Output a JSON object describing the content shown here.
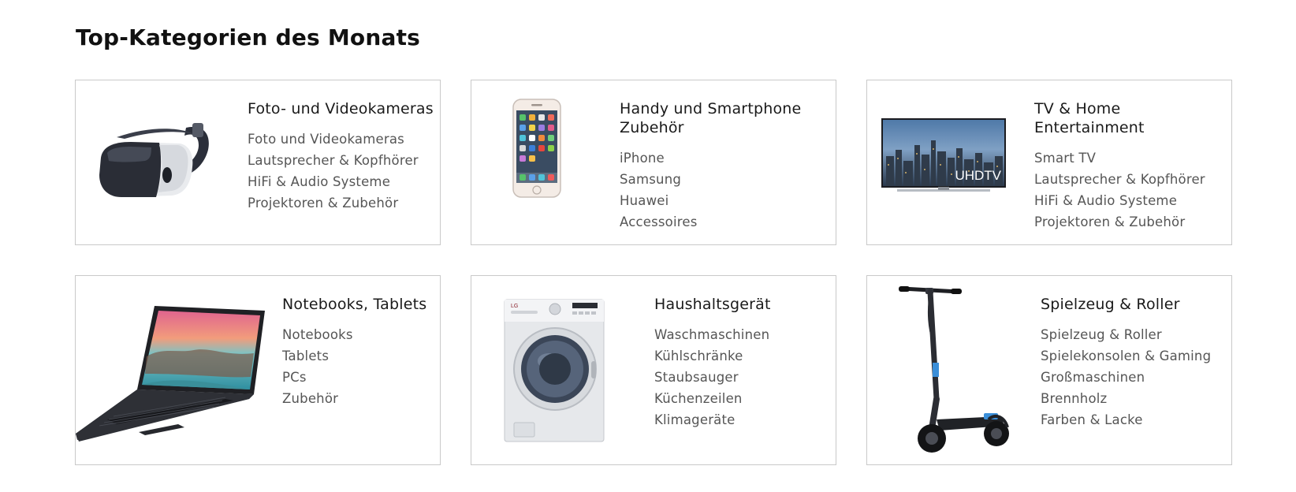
{
  "section": {
    "title": "Top-Kategorien des Monats"
  },
  "cards": [
    {
      "title": "Foto- und Videokameras",
      "icon": "vr-headset-image",
      "links": [
        "Foto und Videokameras",
        "Lautsprecher & Kopfhörer",
        "HiFi & Audio Systeme",
        "Projektoren & Zubehör"
      ]
    },
    {
      "title": "Handy und Smartphone Zubehör",
      "icon": "smartphone-image",
      "links": [
        "iPhone",
        "Samsung",
        "Huawei",
        "Accessoires"
      ]
    },
    {
      "title": "TV & Home Entertainment",
      "icon": "tv-image",
      "tv_badge": "UHDTV",
      "links": [
        "Smart TV",
        "Lautsprecher & Kopfhörer",
        "HiFi & Audio Systeme",
        "Projektoren & Zubehör"
      ]
    },
    {
      "title": "Notebooks, Tablets",
      "icon": "laptop-image",
      "links": [
        "Notebooks",
        "Tablets",
        "PCs",
        "Zubehör"
      ]
    },
    {
      "title": "Haushaltsgerät",
      "icon": "washing-machine-image",
      "brand_mark": "LG",
      "links": [
        "Waschmaschinen",
        "Kühlschränke",
        "Staubsauger",
        "Küchenzeilen",
        "Klimageräte"
      ]
    },
    {
      "title": "Spielzeug & Roller",
      "icon": "scooter-image",
      "links": [
        "Spielzeug & Roller",
        "Spielekonsolen & Gaming",
        "Großmaschinen",
        "Brennholz",
        "Farben & Lacke"
      ]
    }
  ]
}
